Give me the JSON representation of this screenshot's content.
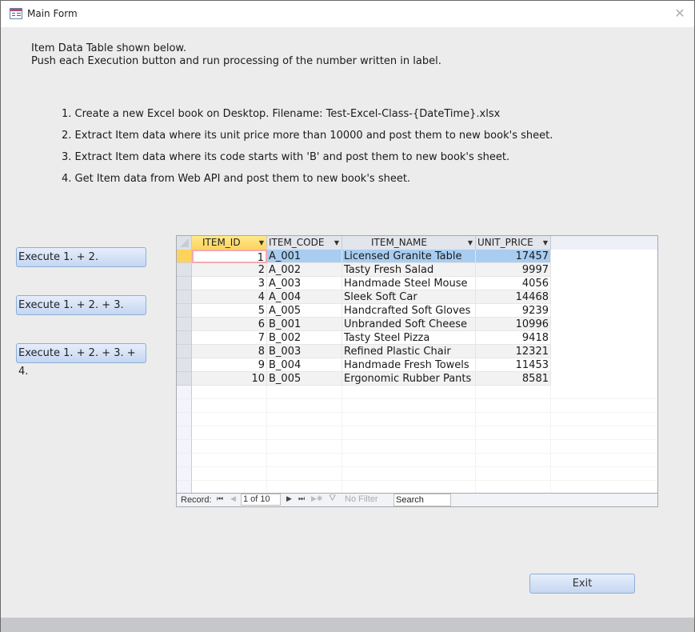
{
  "window": {
    "title": "Main Form",
    "icon": "form-icon",
    "close_icon": "close-icon"
  },
  "intro": {
    "line1": "Item Data Table shown below.",
    "line2": "Push each Execution button and run processing of the number written in label."
  },
  "steps": [
    "1. Create a new Excel book on Desktop. Filename: Test-Excel-Class-{DateTime}.xlsx",
    "2. Extract Item data where its unit price more than 10000 and post them to new book's sheet.",
    "3. Extract Item data where its code starts with 'B' and post them to new book's sheet.",
    "4. Get Item data from Web API and post them to new book's sheet."
  ],
  "buttons": {
    "exec12": "Execute 1. + 2.",
    "exec123": "Execute 1. + 2. + 3.",
    "exec1234": "Execute 1. + 2. + 3. + 4.",
    "exit": "Exit"
  },
  "grid": {
    "columns": [
      "ITEM_ID",
      "ITEM_CODE",
      "ITEM_NAME",
      "UNIT_PRICE"
    ],
    "rows": [
      {
        "id": "1",
        "code": "A_001",
        "name": "Licensed Granite Table",
        "price": "17457"
      },
      {
        "id": "2",
        "code": "A_002",
        "name": "Tasty Fresh Salad",
        "price": "9997"
      },
      {
        "id": "3",
        "code": "A_003",
        "name": "Handmade Steel Mouse",
        "price": "4056"
      },
      {
        "id": "4",
        "code": "A_004",
        "name": "Sleek Soft Car",
        "price": "14468"
      },
      {
        "id": "5",
        "code": "A_005",
        "name": "Handcrafted Soft Gloves",
        "price": "9239"
      },
      {
        "id": "6",
        "code": "B_001",
        "name": "Unbranded Soft Cheese",
        "price": "10996"
      },
      {
        "id": "7",
        "code": "B_002",
        "name": "Tasty Steel Pizza",
        "price": "9418"
      },
      {
        "id": "8",
        "code": "B_003",
        "name": "Refined Plastic Chair",
        "price": "12321"
      },
      {
        "id": "9",
        "code": "B_004",
        "name": "Handmade Fresh Towels",
        "price": "11453"
      },
      {
        "id": "10",
        "code": "B_005",
        "name": "Ergonomic Rubber Pants",
        "price": "8581"
      }
    ],
    "selected_row": 1
  },
  "navigator": {
    "record_label": "Record:",
    "record_value": "1 of 10",
    "filter_label": "No Filter",
    "search_value": "Search",
    "icons": {
      "first": "first-record-icon",
      "prev": "previous-record-icon",
      "next": "next-record-icon",
      "last": "last-record-icon",
      "new": "new-record-icon",
      "filter": "no-filter-icon"
    }
  }
}
